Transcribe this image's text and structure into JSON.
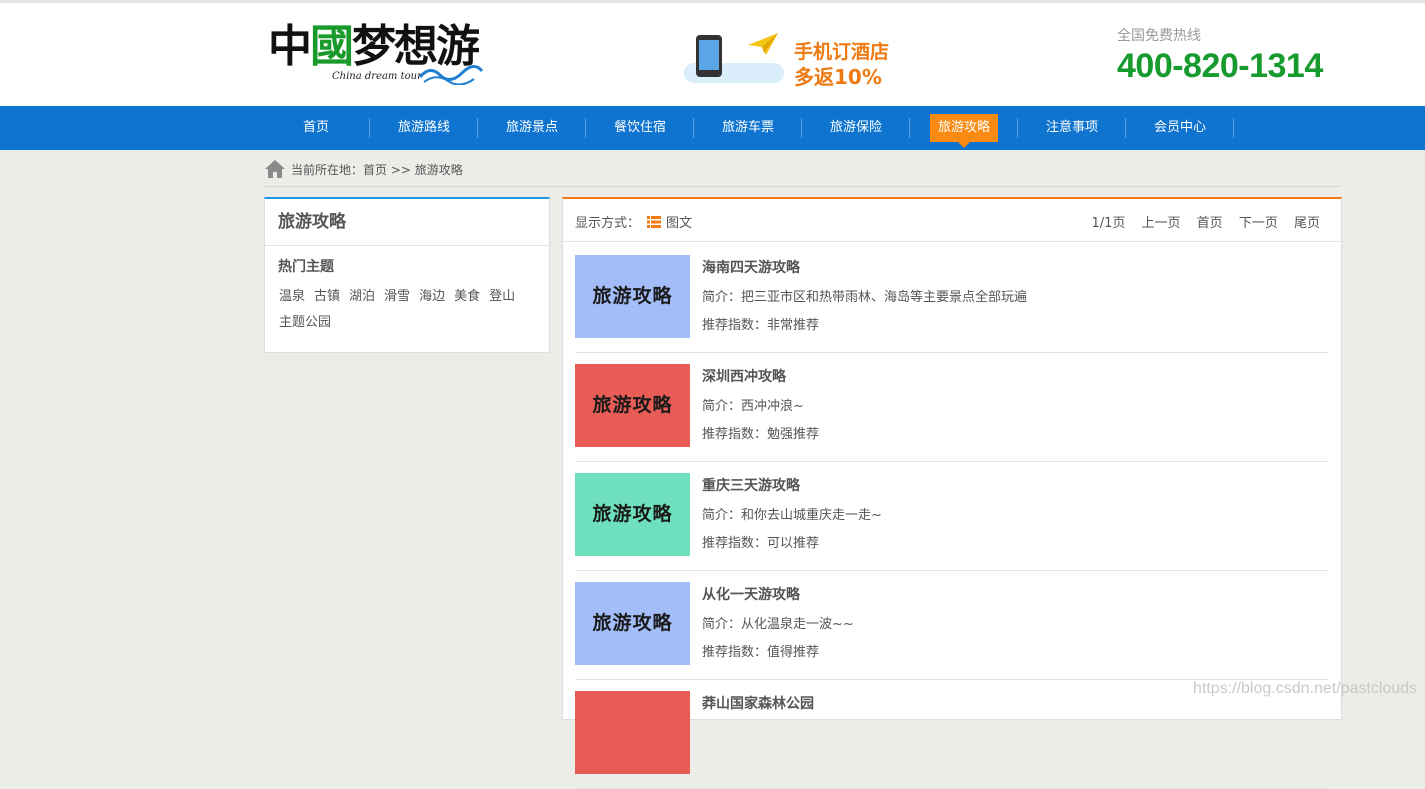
{
  "header": {
    "logo_text": "中國梦想游",
    "logo_subtitle": "China dream tour",
    "promo_line1": "手机订酒店",
    "promo_line2": "多返10%",
    "hotline_label": "全国免费热线",
    "hotline_number": "400-820-1314"
  },
  "nav": {
    "items": [
      {
        "label": "首页"
      },
      {
        "label": "旅游路线"
      },
      {
        "label": "旅游景点"
      },
      {
        "label": "餐饮住宿"
      },
      {
        "label": "旅游车票"
      },
      {
        "label": "旅游保险"
      },
      {
        "label": "旅游攻略"
      },
      {
        "label": "注意事项"
      },
      {
        "label": "会员中心"
      }
    ],
    "active_index": 6
  },
  "breadcrumb": {
    "text": "当前所在地：首页 >> 旅游攻略"
  },
  "sidebar": {
    "title": "旅游攻略",
    "subtitle": "热门主题",
    "tags": [
      "温泉",
      "古镇",
      "湖泊",
      "滑雪",
      "海边",
      "美食",
      "登山",
      "主题公园"
    ]
  },
  "toolbar": {
    "display_label": "显示方式：",
    "view_label": "图文",
    "page_info": "1/1页",
    "prev": "上一页",
    "first": "首页",
    "next": "下一页",
    "last": "尾页"
  },
  "articles": [
    {
      "thumb_text": "旅游攻略",
      "thumb_color": "#a2bdf7",
      "title": "海南四天游攻略",
      "intro": "简介：把三亚市区和热带雨林、海岛等主要景点全部玩遍",
      "rating": "推荐指数：非常推荐"
    },
    {
      "thumb_text": "旅游攻略",
      "thumb_color": "#e85c55",
      "title": "深圳西冲攻略",
      "intro": "简介：西冲冲浪~",
      "rating": "推荐指数：勉强推荐"
    },
    {
      "thumb_text": "旅游攻略",
      "thumb_color": "#6ee0bd",
      "title": "重庆三天游攻略",
      "intro": "简介：和你去山城重庆走一走~",
      "rating": "推荐指数：可以推荐"
    },
    {
      "thumb_text": "旅游攻略",
      "thumb_color": "#a2bdf7",
      "title": "从化一天游攻略",
      "intro": "简介：从化温泉走一波~~",
      "rating": "推荐指数：值得推荐"
    },
    {
      "thumb_text": "",
      "thumb_color": "#e85c55",
      "title": "莽山国家森林公园",
      "intro": "",
      "rating": ""
    }
  ],
  "watermark": "https://blog.csdn.net/pastclouds",
  "colors": {
    "nav_bg": "#0f74cf",
    "nav_active": "#f98b14",
    "hotline": "#179a2e",
    "promo": "#f07a12"
  }
}
